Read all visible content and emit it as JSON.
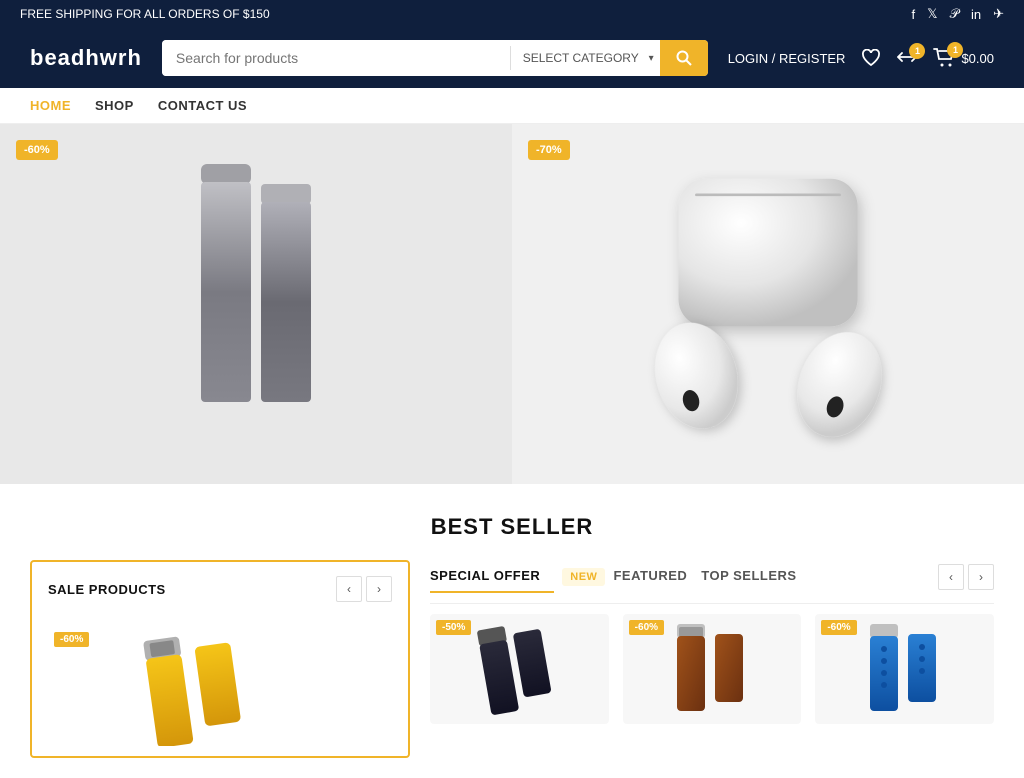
{
  "announcement": {
    "text": "FREE SHIPPING FOR ALL ORDERS OF $150"
  },
  "header": {
    "logo": "beadhwrh",
    "search_placeholder": "Search for products",
    "category_label": "SELECT CATEGORY",
    "login_label": "LOGIN / REGISTER",
    "wishlist_badge": "",
    "compare_badge": "1",
    "cart_badge": "1",
    "cart_total": "$0.00"
  },
  "social_icons": [
    "f",
    "𝕏",
    "𝒫",
    "in",
    "✈"
  ],
  "nav": {
    "items": [
      {
        "label": "HOME",
        "active": true
      },
      {
        "label": "SHOP",
        "active": false
      },
      {
        "label": "CONTACT US",
        "active": false
      }
    ]
  },
  "hero": {
    "left_badge": "-60%",
    "right_badge": "-70%"
  },
  "best_seller": {
    "title": "BEST SELLER"
  },
  "sale_products": {
    "title": "SALE PRODUCTS",
    "badge": "-60%"
  },
  "special_offer": {
    "tabs": [
      {
        "label": "SPECIAL OFFER",
        "active": true
      },
      {
        "label": "NEW",
        "type": "new"
      },
      {
        "label": "FEATURED",
        "active": false
      },
      {
        "label": "TOP SELLERS",
        "active": false
      }
    ],
    "products": [
      {
        "discount": "-50%"
      },
      {
        "discount": "-60%"
      },
      {
        "discount": "-60%"
      }
    ]
  },
  "icons": {
    "search": "🔍",
    "heart": "♡",
    "compare": "⇄",
    "cart": "🛒",
    "arrow_left": "‹",
    "arrow_right": "›",
    "chevron_down": "▾"
  }
}
